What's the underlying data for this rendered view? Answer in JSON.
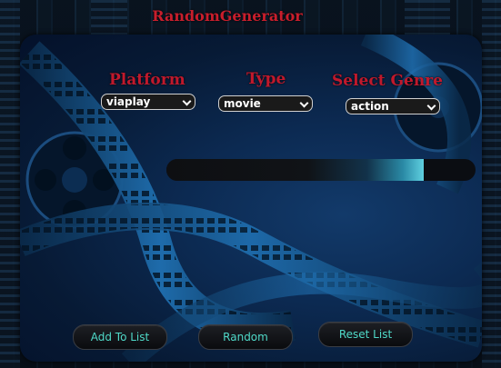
{
  "app": {
    "title": "RandomGenerator"
  },
  "filters": {
    "platform": {
      "label": "Platform",
      "value": "viaplay"
    },
    "type": {
      "label": "Type",
      "value": "movie"
    },
    "genre": {
      "label": "Select Genre",
      "value": "action"
    }
  },
  "result": {
    "text": ""
  },
  "buttons": {
    "add": "Add To List",
    "random": "Random",
    "reset": "Reset List"
  },
  "colors": {
    "label_red": "#c0192c",
    "button_text": "#4fd9c8",
    "panel_blue": "#0c2a52"
  }
}
